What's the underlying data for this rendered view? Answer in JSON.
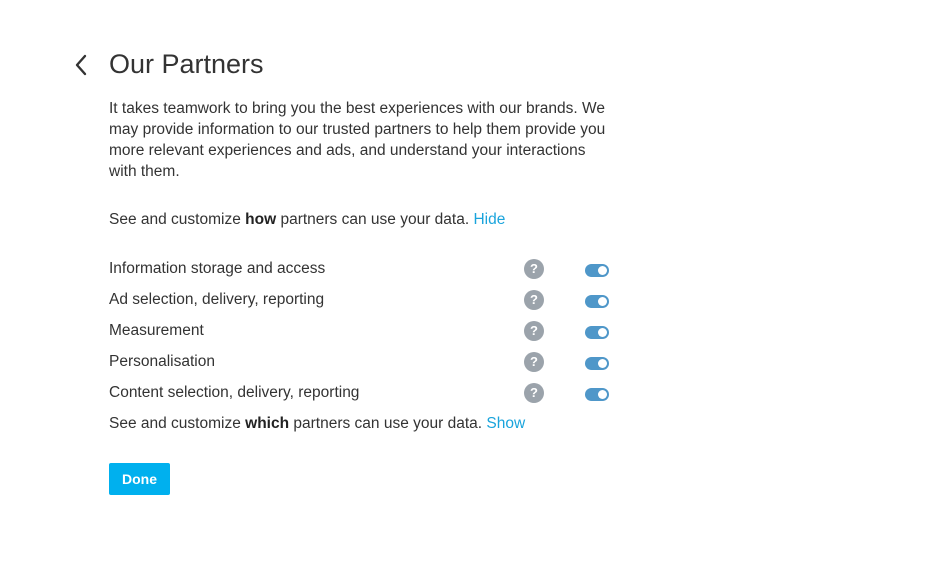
{
  "header": {
    "title": "Our Partners"
  },
  "intro": {
    "text": "It takes teamwork to bring you the best experiences with our brands. We may provide information to our trusted partners to help them provide you more relevant experiences and ads, and understand your interactions with them."
  },
  "customize_how": {
    "prefix": "See and customize ",
    "bold": "how",
    "suffix": " partners can use your data. ",
    "link": "Hide"
  },
  "purposes": [
    {
      "label": "Information storage and access",
      "help": "?",
      "enabled": true
    },
    {
      "label": "Ad selection, delivery, reporting",
      "help": "?",
      "enabled": true
    },
    {
      "label": "Measurement",
      "help": "?",
      "enabled": true
    },
    {
      "label": "Personalisation",
      "help": "?",
      "enabled": true
    },
    {
      "label": "Content selection, delivery, reporting",
      "help": "?",
      "enabled": true
    }
  ],
  "customize_which": {
    "prefix": "See and customize ",
    "bold": "which",
    "suffix": " partners can use your data. ",
    "link": "Show"
  },
  "actions": {
    "done_label": "Done"
  },
  "colors": {
    "accent": "#00b0ee",
    "link": "#1aa4dc",
    "toggle_on": "#4f97c9",
    "help_icon": "#9ba3ab"
  },
  "icons": {
    "back": "chevron-left-icon",
    "help": "question-circle-icon"
  }
}
